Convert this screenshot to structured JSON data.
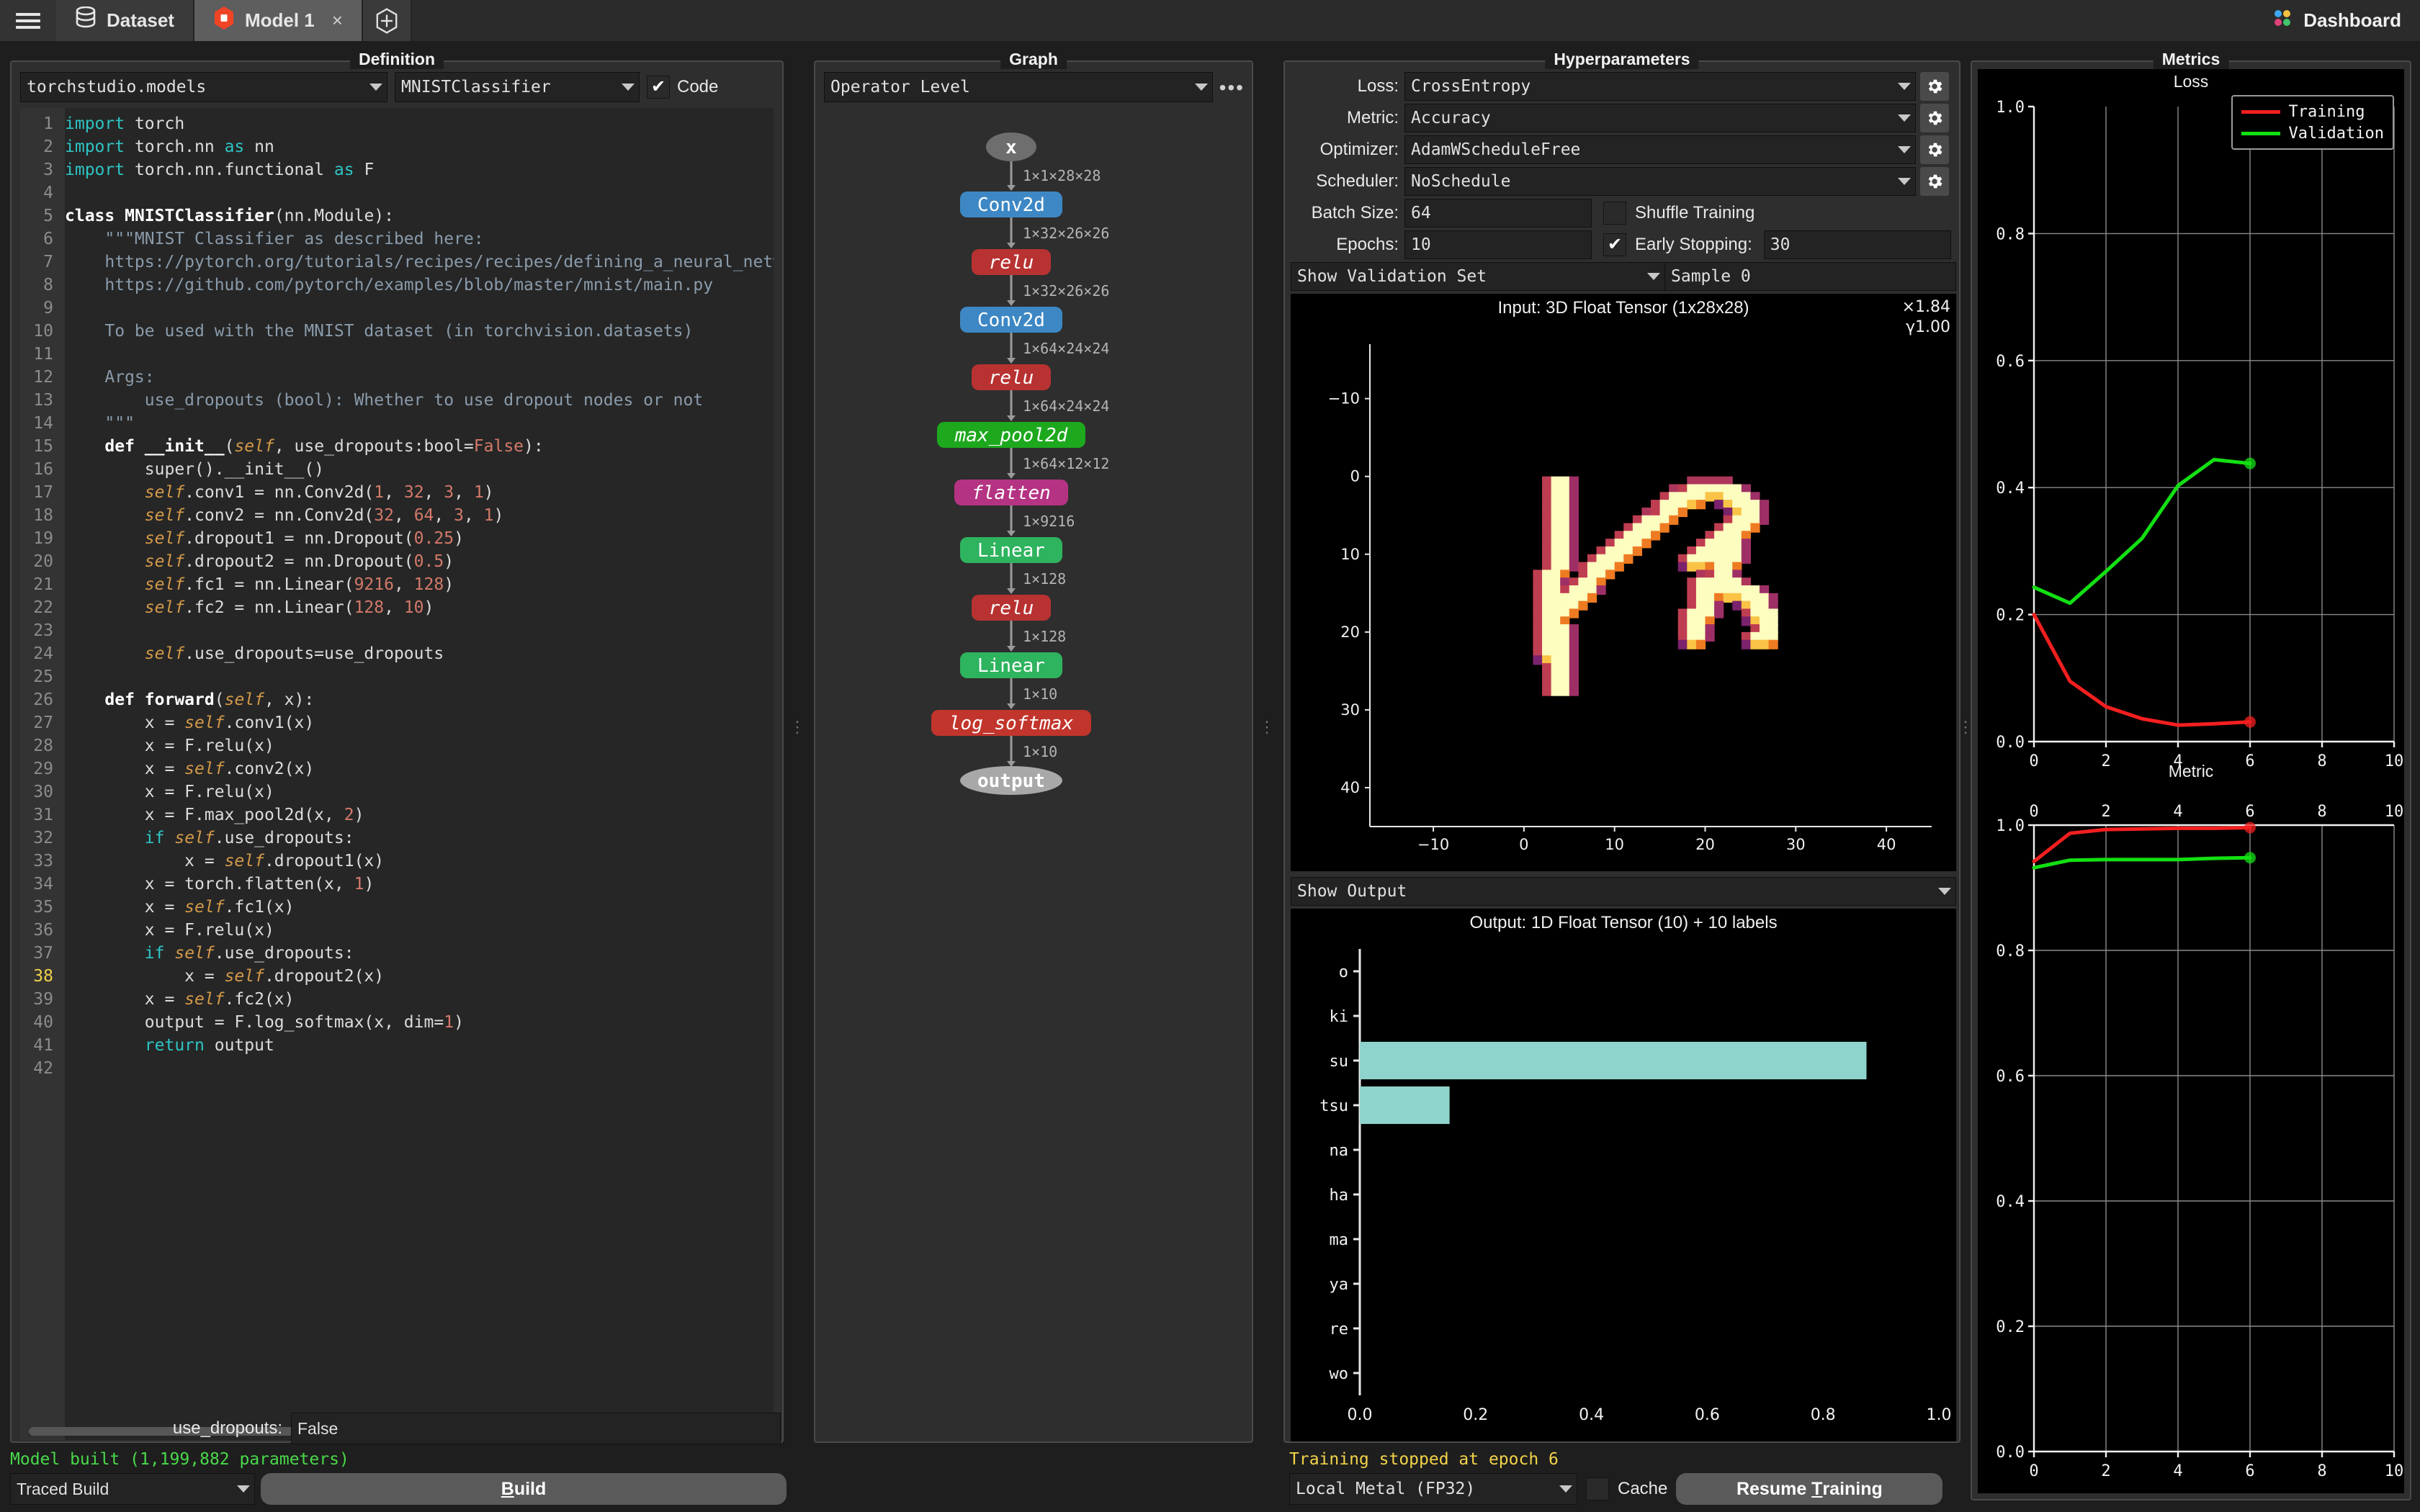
{
  "topbar": {
    "menu_icon": "hamburger-menu-icon",
    "tabs": [
      {
        "label": "Dataset",
        "icon": "database-icon",
        "active": false
      },
      {
        "label": "Model 1",
        "icon": "model-hexagon-icon",
        "active": true,
        "close": "×"
      }
    ],
    "add_tab": "+",
    "dashboard_label": "Dashboard",
    "dashboard_icon": "dashboard-dots-icon"
  },
  "definition": {
    "title": "Definition",
    "module_select": "torchstudio.models",
    "class_select": "MNISTClassifier",
    "code_checkbox_label": "Code",
    "code_checkbox_checked": true,
    "param_label": "use_dropouts:",
    "param_value": "False",
    "status": "Model built (1,199,882 parameters)",
    "build_mode": "Traced Build",
    "build_button": "Build",
    "code_lines": [
      {
        "n": 1,
        "html": "<span class='kw'>import</span> torch"
      },
      {
        "n": 2,
        "html": "<span class='kw'>import</span> torch.nn <span class='kw'>as</span> nn"
      },
      {
        "n": 3,
        "html": "<span class='kw'>import</span> torch.nn.functional <span class='kw'>as</span> F"
      },
      {
        "n": 4,
        "html": ""
      },
      {
        "n": 5,
        "html": "<span class='kw2'>class</span> <span class='cls'>MNISTClassifier</span>(nn.Module):"
      },
      {
        "n": 6,
        "html": "    <span class='str'>\"\"\"MNIST Classifier as described here:</span>"
      },
      {
        "n": 7,
        "html": "    <span class='str'>https://pytorch.org/tutorials/recipes/recipes/defining_a_neural_netw</span>"
      },
      {
        "n": 8,
        "html": "    <span class='str'>https://github.com/pytorch/examples/blob/master/mnist/main.py</span>"
      },
      {
        "n": 9,
        "html": ""
      },
      {
        "n": 10,
        "html": "    <span class='str'>To be used with the MNIST dataset (in torchvision.datasets)</span>"
      },
      {
        "n": 11,
        "html": ""
      },
      {
        "n": 12,
        "html": "    <span class='str'>Args:</span>"
      },
      {
        "n": 13,
        "html": "        <span class='str'>use_dropouts (bool): Whether to use dropout nodes or not</span>"
      },
      {
        "n": 14,
        "html": "    <span class='str'>\"\"\"</span>"
      },
      {
        "n": 15,
        "html": "    <span class='kw2'>def</span> <span class='fn'>__init__</span>(<span class='self'>self</span>, use_dropouts:bool=<span class='num'>False</span>):"
      },
      {
        "n": 16,
        "html": "        super().__init__()"
      },
      {
        "n": 17,
        "html": "        <span class='self'>self</span>.conv1 = nn.Conv2d(<span class='num'>1</span>, <span class='num'>32</span>, <span class='num'>3</span>, <span class='num'>1</span>)"
      },
      {
        "n": 18,
        "html": "        <span class='self'>self</span>.conv2 = nn.Conv2d(<span class='num'>32</span>, <span class='num'>64</span>, <span class='num'>3</span>, <span class='num'>1</span>)"
      },
      {
        "n": 19,
        "html": "        <span class='self'>self</span>.dropout1 = nn.Dropout(<span class='num'>0.25</span>)"
      },
      {
        "n": 20,
        "html": "        <span class='self'>self</span>.dropout2 = nn.Dropout(<span class='num'>0.5</span>)"
      },
      {
        "n": 21,
        "html": "        <span class='self'>self</span>.fc1 = nn.Linear(<span class='num'>9216</span>, <span class='num'>128</span>)"
      },
      {
        "n": 22,
        "html": "        <span class='self'>self</span>.fc2 = nn.Linear(<span class='num'>128</span>, <span class='num'>10</span>)"
      },
      {
        "n": 23,
        "html": ""
      },
      {
        "n": 24,
        "html": "        <span class='self'>self</span>.use_dropouts=use_dropouts"
      },
      {
        "n": 25,
        "html": ""
      },
      {
        "n": 26,
        "html": "    <span class='kw2'>def</span> <span class='fn'>forward</span>(<span class='self'>self</span>, x):"
      },
      {
        "n": 27,
        "html": "        x = <span class='self'>self</span>.conv1(x)"
      },
      {
        "n": 28,
        "html": "        x = F.relu(x)"
      },
      {
        "n": 29,
        "html": "        x = <span class='self'>self</span>.conv2(x)"
      },
      {
        "n": 30,
        "html": "        x = F.relu(x)"
      },
      {
        "n": 31,
        "html": "        x = F.max_pool2d(x, <span class='num'>2</span>)"
      },
      {
        "n": 32,
        "html": "        <span class='kw'>if</span> <span class='self'>self</span>.use_dropouts:"
      },
      {
        "n": 33,
        "html": "            x = <span class='self'>self</span>.dropout1(x)"
      },
      {
        "n": 34,
        "html": "        x = torch.flatten(x, <span class='num'>1</span>)"
      },
      {
        "n": 35,
        "html": "        x = <span class='self'>self</span>.fc1(x)"
      },
      {
        "n": 36,
        "html": "        x = F.relu(x)"
      },
      {
        "n": 37,
        "html": "        <span class='kw'>if</span> <span class='self'>self</span>.use_dropouts:"
      },
      {
        "n": 38,
        "html": "            x = <span class='self'>self</span>.dropout2(x)",
        "highlight": true
      },
      {
        "n": 39,
        "html": "        x = <span class='self'>self</span>.fc2(x)"
      },
      {
        "n": 40,
        "html": "        output = F.log_softmax(x, dim=<span class='num'>1</span>)"
      },
      {
        "n": 41,
        "html": "        <span class='kw'>return</span> output"
      },
      {
        "n": 42,
        "html": ""
      }
    ]
  },
  "graph": {
    "title": "Graph",
    "level_select": "Operator Level",
    "more_button": "•••",
    "nodes": [
      {
        "label": "x",
        "shape": "ellipse",
        "color": "#6e6e6e",
        "italic": false,
        "bold": true
      },
      {
        "label": "Conv2d",
        "shape": "rect",
        "color": "#3d88c4",
        "italic": false,
        "bold": false
      },
      {
        "label": "relu",
        "shape": "rect",
        "color": "#b83232",
        "italic": true,
        "bold": false
      },
      {
        "label": "Conv2d",
        "shape": "rect",
        "color": "#3d88c4",
        "italic": false,
        "bold": false
      },
      {
        "label": "relu",
        "shape": "rect",
        "color": "#b83232",
        "italic": true,
        "bold": false
      },
      {
        "label": "max_pool2d",
        "shape": "rect",
        "color": "#1da81d",
        "italic": true,
        "bold": false
      },
      {
        "label": "flatten",
        "shape": "rect",
        "color": "#b53383",
        "italic": true,
        "bold": false
      },
      {
        "label": "Linear",
        "shape": "rect",
        "color": "#2eb35e",
        "italic": false,
        "bold": false
      },
      {
        "label": "relu",
        "shape": "rect",
        "color": "#b83232",
        "italic": true,
        "bold": false
      },
      {
        "label": "Linear",
        "shape": "rect",
        "color": "#2eb35e",
        "italic": false,
        "bold": false
      },
      {
        "label": "log_softmax",
        "shape": "rect",
        "color": "#c2352c",
        "italic": true,
        "bold": false
      },
      {
        "label": "output",
        "shape": "ellipse",
        "color": "#a8a8a8",
        "italic": false,
        "bold": true
      }
    ],
    "edge_labels": [
      "1×1×28×28",
      "1×32×26×26",
      "1×32×26×26",
      "1×64×24×24",
      "1×64×24×24",
      "1×64×12×12",
      "1×9216",
      "1×128",
      "1×128",
      "1×10",
      "1×10"
    ]
  },
  "hyperparameters": {
    "title": "Hyperparameters",
    "fields": [
      {
        "label": "Loss:",
        "value": "CrossEntropy"
      },
      {
        "label": "Metric:",
        "value": "Accuracy"
      },
      {
        "label": "Optimizer:",
        "value": "AdamWScheduleFree"
      },
      {
        "label": "Scheduler:",
        "value": "NoSchedule"
      }
    ],
    "batch_size_label": "Batch Size:",
    "batch_size_value": "64",
    "shuffle_label": "Shuffle Training",
    "shuffle_checked": false,
    "epochs_label": "Epochs:",
    "epochs_value": "10",
    "early_stopping_label": "Early Stopping:",
    "early_stopping_checked": true,
    "early_stopping_value": "30",
    "validation_select": "Show Validation Set",
    "sample_label": "Sample 0",
    "input_title": "Input: 3D Float Tensor (1x28x28)",
    "input_scale_x": "×1.84",
    "input_scale_y": "γ1.00",
    "input_x_ticks": [
      "-10",
      "0",
      "10",
      "20",
      "30",
      "40"
    ],
    "input_y_ticks": [
      "-10",
      "0",
      "10",
      "20",
      "30",
      "40"
    ],
    "output_select": "Show Output",
    "status": "Training stopped at epoch 6",
    "device_select": "Local Metal (FP32)",
    "cache_label": "Cache",
    "cache_checked": false,
    "resume_button": "Resume Training"
  },
  "metrics": {
    "title": "Metrics"
  },
  "chart_data": [
    {
      "type": "line",
      "title": "Loss",
      "xlabel": "",
      "ylabel": "",
      "xlim": [
        0,
        10
      ],
      "ylim": [
        0.0,
        1.0
      ],
      "x_ticks": [
        0,
        2,
        4,
        6,
        8,
        10
      ],
      "y_ticks": [
        0.0,
        0.2,
        0.4,
        0.6,
        0.8,
        1.0
      ],
      "grid": true,
      "legend_position": "top-right",
      "series": [
        {
          "name": "Training",
          "color": "#f41f1f",
          "x": [
            0,
            1,
            2,
            3,
            4,
            5,
            6
          ],
          "values": [
            0.2,
            0.095,
            0.055,
            0.036,
            0.026,
            0.028,
            0.031
          ]
        },
        {
          "name": "Validation",
          "color": "#13e013",
          "x": [
            0,
            1,
            2,
            3,
            4,
            5,
            6
          ],
          "values": [
            0.243,
            0.218,
            0.268,
            0.32,
            0.403,
            0.444,
            0.438
          ]
        }
      ]
    },
    {
      "type": "line",
      "title": "Metric",
      "xlabel": "",
      "ylabel": "",
      "xlim": [
        0,
        10
      ],
      "ylim": [
        0.0,
        1.0
      ],
      "x_ticks": [
        0,
        2,
        4,
        6,
        8,
        10
      ],
      "y_ticks": [
        0.0,
        0.2,
        0.4,
        0.6,
        0.8,
        1.0
      ],
      "grid": true,
      "legend_position": "none",
      "series": [
        {
          "name": "Training",
          "color": "#f41f1f",
          "x": [
            0,
            1,
            2,
            3,
            4,
            5,
            6
          ],
          "values": [
            0.942,
            0.987,
            0.993,
            0.994,
            0.995,
            0.995,
            0.996
          ]
        },
        {
          "name": "Validation",
          "color": "#13e013",
          "x": [
            0,
            1,
            2,
            3,
            4,
            5,
            6
          ],
          "values": [
            0.932,
            0.944,
            0.945,
            0.945,
            0.945,
            0.947,
            0.948
          ]
        }
      ]
    },
    {
      "type": "bar",
      "orientation": "horizontal",
      "title": "Output: 1D Float Tensor (10) + 10 labels",
      "categories": [
        "o",
        "ki",
        "su",
        "tsu",
        "na",
        "ha",
        "ma",
        "ya",
        "re",
        "wo"
      ],
      "values": [
        0.0,
        0.0,
        0.875,
        0.155,
        0.0,
        0.0,
        0.0,
        0.0,
        0.0,
        0.0
      ],
      "bar_color": "#8ed4cc",
      "xlim": [
        0.0,
        1.0
      ],
      "x_ticks": [
        0.0,
        0.2,
        0.4,
        0.6,
        0.8,
        1.0
      ],
      "x_tick_labels": [
        "0.0",
        "0.2",
        "0.4",
        "0.6",
        "0.8",
        "1.0"
      ],
      "grid": false
    }
  ]
}
